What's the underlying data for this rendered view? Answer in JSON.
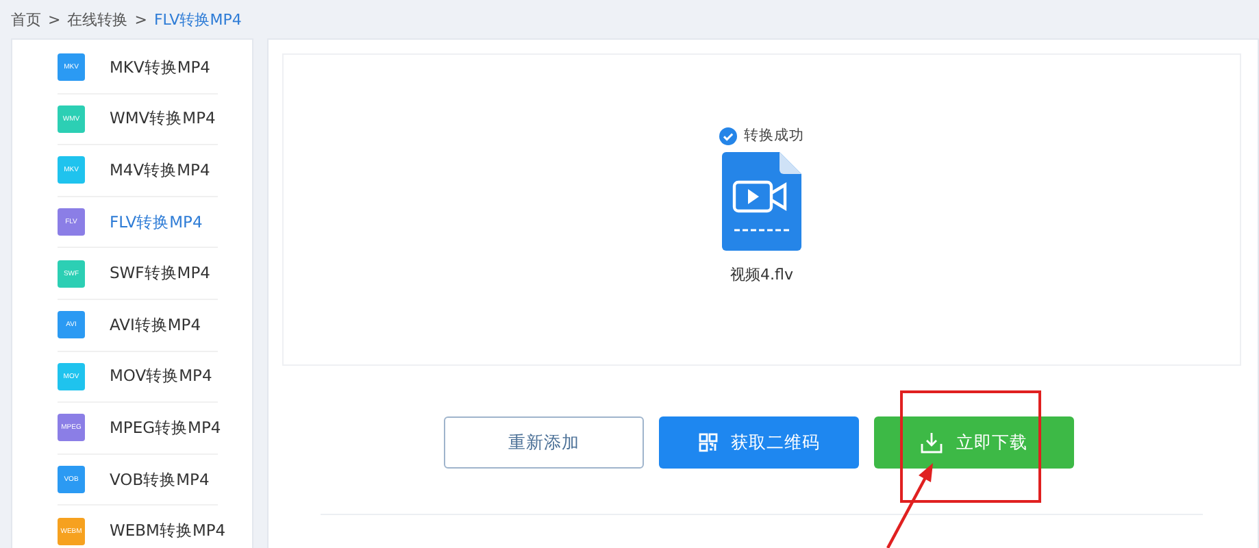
{
  "breadcrumb": [
    {
      "label": "首页",
      "selected": false
    },
    {
      "label": "在线转换",
      "selected": false
    },
    {
      "label": "FLV转换MP4",
      "selected": true
    }
  ],
  "breadcrumb_separator": ">",
  "sidebar": {
    "items": [
      {
        "badge": "MKV",
        "label": "MKV转换MP4",
        "color": "#2b9af3",
        "selected": false
      },
      {
        "badge": "WMV",
        "label": "WMV转换MP4",
        "color": "#2ccfb4",
        "selected": false
      },
      {
        "badge": "MKV",
        "label": "M4V转换MP4",
        "color": "#1fc3ee",
        "selected": false
      },
      {
        "badge": "FLV",
        "label": "FLV转换MP4",
        "color": "#8b7ee6",
        "selected": true
      },
      {
        "badge": "SWF",
        "label": "SWF转换MP4",
        "color": "#2ccfb4",
        "selected": false
      },
      {
        "badge": "AVI",
        "label": "AVI转换MP4",
        "color": "#2b9af3",
        "selected": false
      },
      {
        "badge": "MOV",
        "label": "MOV转换MP4",
        "color": "#1fc3ee",
        "selected": false
      },
      {
        "badge": "MPEG",
        "label": "MPEG转换MP4",
        "color": "#8b7ee6",
        "selected": false
      },
      {
        "badge": "VOB",
        "label": "VOB转换MP4",
        "color": "#2b9af3",
        "selected": false
      },
      {
        "badge": "WEBM",
        "label": "WEBM转换MP4",
        "color": "#f6a11f",
        "selected": false
      }
    ]
  },
  "result": {
    "status": "转换成功",
    "file_name": "视频4.flv"
  },
  "buttons": [
    {
      "kind": "outline",
      "label": "重新添加"
    },
    {
      "kind": "qrcode",
      "label": "获取二维码"
    },
    {
      "kind": "download",
      "label": "立即下载"
    }
  ]
}
